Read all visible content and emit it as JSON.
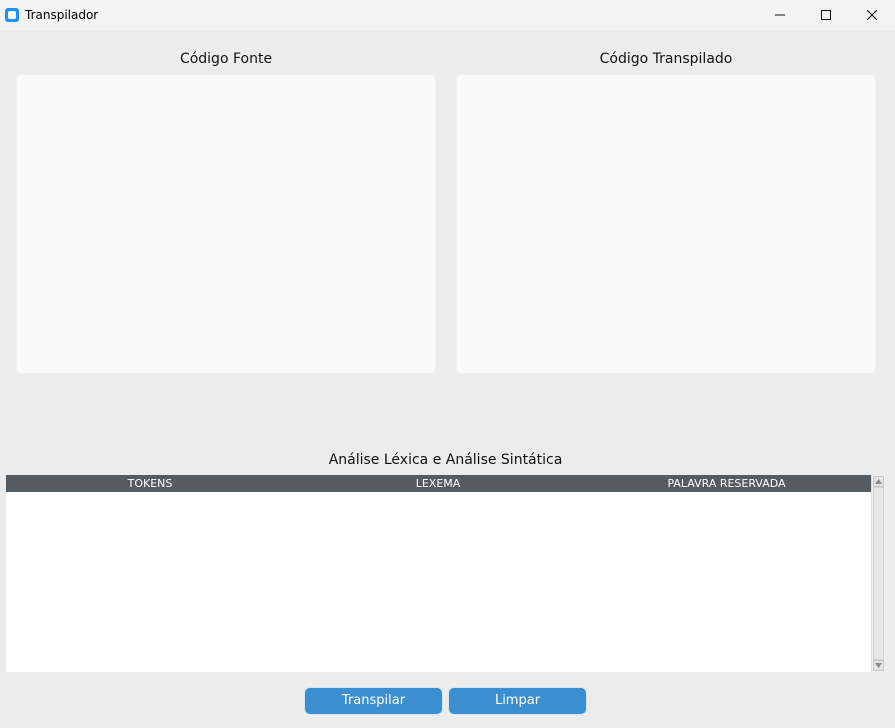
{
  "window": {
    "title": "Transpilador",
    "icon": "app-icon",
    "controls": [
      "minimize-icon",
      "maximize-icon",
      "close-icon"
    ]
  },
  "source_panel": {
    "label": "Código Fonte",
    "content": ""
  },
  "output_panel": {
    "label": "Código Transpilado",
    "content": ""
  },
  "analysis": {
    "title": "Análise Léxica e Análise Sintática",
    "columns": [
      "TOKENS",
      "LEXEMA",
      "PALAVRA RESERVADA"
    ],
    "rows": []
  },
  "buttons": {
    "transpile": "Transpilar",
    "clear": "Limpar"
  },
  "colors": {
    "accent": "#3b8ed0",
    "table_header": "#555b5e",
    "background": "#ececec",
    "editor_bg": "#fafafa"
  }
}
